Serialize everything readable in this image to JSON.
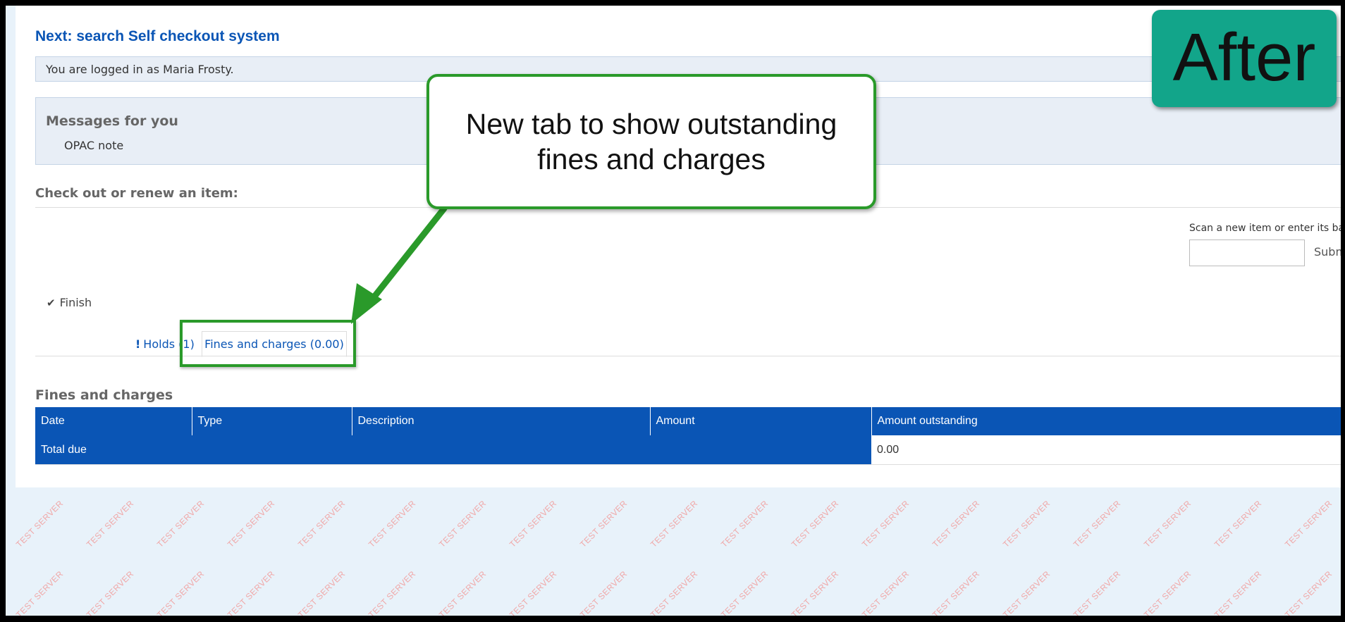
{
  "page": {
    "title": "Next: search Self checkout system",
    "login_message": "You are logged in as Maria Frosty.",
    "watermark_text": "TEST SERVER"
  },
  "messages": {
    "title": "Messages for you",
    "body": "OPAC note"
  },
  "checkout": {
    "heading": "Check out or renew an item:",
    "scan_label": "Scan a new item or enter its barcode:",
    "barcode_value": "",
    "submit_label": "Submit",
    "finish_label": "Finish"
  },
  "tabs": [
    {
      "label": "Holds (1)",
      "active": false
    },
    {
      "label": "Fines and charges (0.00)",
      "active": true
    }
  ],
  "fines": {
    "heading": "Fines and charges",
    "columns": [
      "Date",
      "Type",
      "Description",
      "Amount",
      "Amount outstanding"
    ],
    "total_label": "Total due",
    "total_value": "0.00"
  },
  "annotation": {
    "callout_text": "New tab to show outstanding fines and charges",
    "badge_text": "After",
    "accent_color": "#2a9a2a",
    "badge_color": "#12a58a"
  },
  "colors": {
    "brand_blue": "#0a55b5",
    "panel_bg": "#e8eef6",
    "outer_bg": "#e8f2fa"
  }
}
